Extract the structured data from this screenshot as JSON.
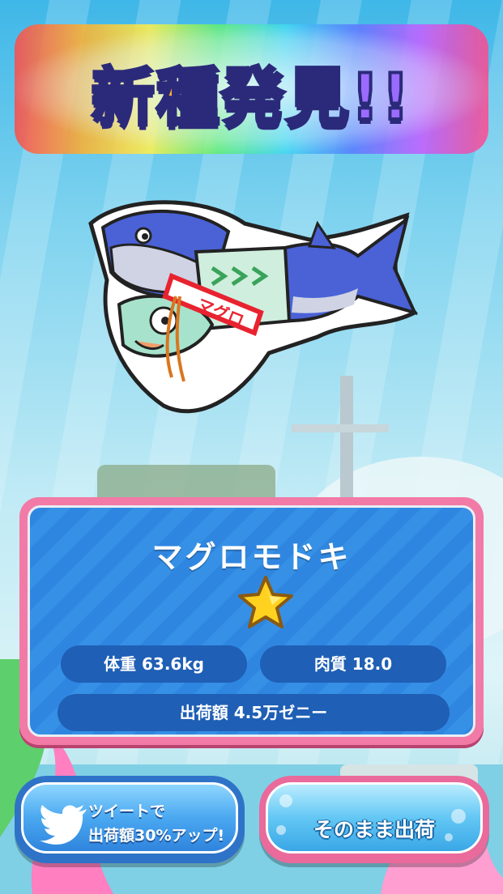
{
  "title": {
    "chars": [
      "新",
      "種",
      "発",
      "見",
      "!!"
    ]
  },
  "fish": {
    "name": "マグロモドキ",
    "rarity_stars": 1,
    "weight_label": "体重 63.6kg",
    "quality_label": "肉質 18.0",
    "price_label": "出荷額 4.5万ゼニー",
    "sash_text": "マグロ"
  },
  "buttons": {
    "tweet_line1": "ツイートで",
    "tweet_line2": "出荷額30%アップ!",
    "ship_label": "そのまま出荷"
  },
  "icons": {
    "tweet": "twitter-bird-icon",
    "rarity": "star-icon"
  },
  "colors": {
    "panel_border": "#f27aa6",
    "panel_bg": "#2f86e0",
    "pill_bg": "#1f5fb5",
    "star": "#ffd21f"
  }
}
